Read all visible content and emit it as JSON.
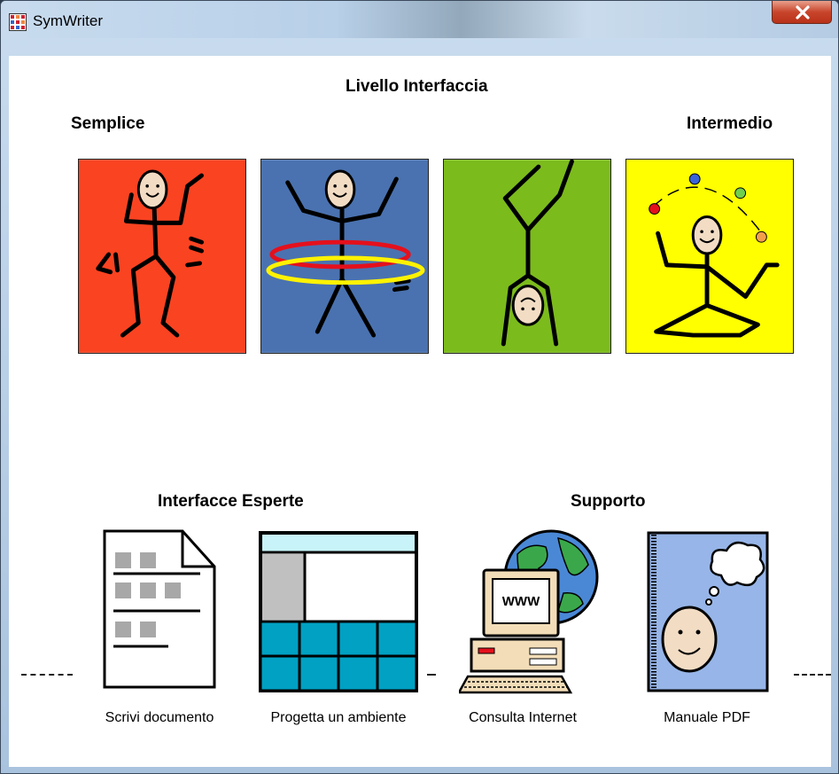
{
  "window": {
    "title": "SymWriter"
  },
  "headings": {
    "level": "Livello Interfaccia",
    "simple": "Semplice",
    "intermediate": "Intermedio",
    "expert": "Interfacce Esperte",
    "support": "Supporto"
  },
  "level_tiles": [
    {
      "name": "dancing-figure",
      "color": "#fa4321"
    },
    {
      "name": "hula-hoop-figure",
      "color": "#4a72b0"
    },
    {
      "name": "handstand-figure",
      "color": "#7cbb1c"
    },
    {
      "name": "juggling-figure",
      "color": "#ffff00"
    }
  ],
  "tools": [
    {
      "label": "Scrivi documento",
      "icon": "document-icon"
    },
    {
      "label": "Progetta un ambiente",
      "icon": "grid-environment-icon"
    },
    {
      "label": "Consulta Internet",
      "icon": "computer-globe-icon"
    },
    {
      "label": "Manuale PDF",
      "icon": "manual-book-icon"
    }
  ],
  "colors": {
    "close_button": "#c8452c",
    "grid_cell": "#00a1c3",
    "grid_header": "#c8f3f8"
  }
}
